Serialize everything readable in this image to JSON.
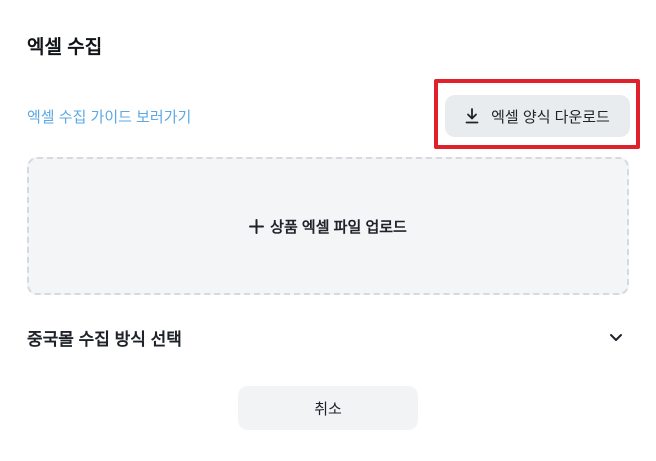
{
  "header": {
    "title": "엑셀 수집"
  },
  "guide": {
    "link_label": "엑셀 수집 가이드 보러가기"
  },
  "download": {
    "label": "엑셀 양식 다운로드",
    "icon": "download-icon",
    "highlight_color": "#e0202a"
  },
  "upload": {
    "label": "상품 엑셀 파일 업로드",
    "icon": "plus-icon"
  },
  "method_select": {
    "label": "중국몰 수집 방식 선택",
    "icon": "chevron-down-icon"
  },
  "footer": {
    "cancel_label": "취소"
  },
  "colors": {
    "link": "#5aa9e6",
    "button_bg": "#e9ecef",
    "upload_bg": "#f3f5f7"
  }
}
